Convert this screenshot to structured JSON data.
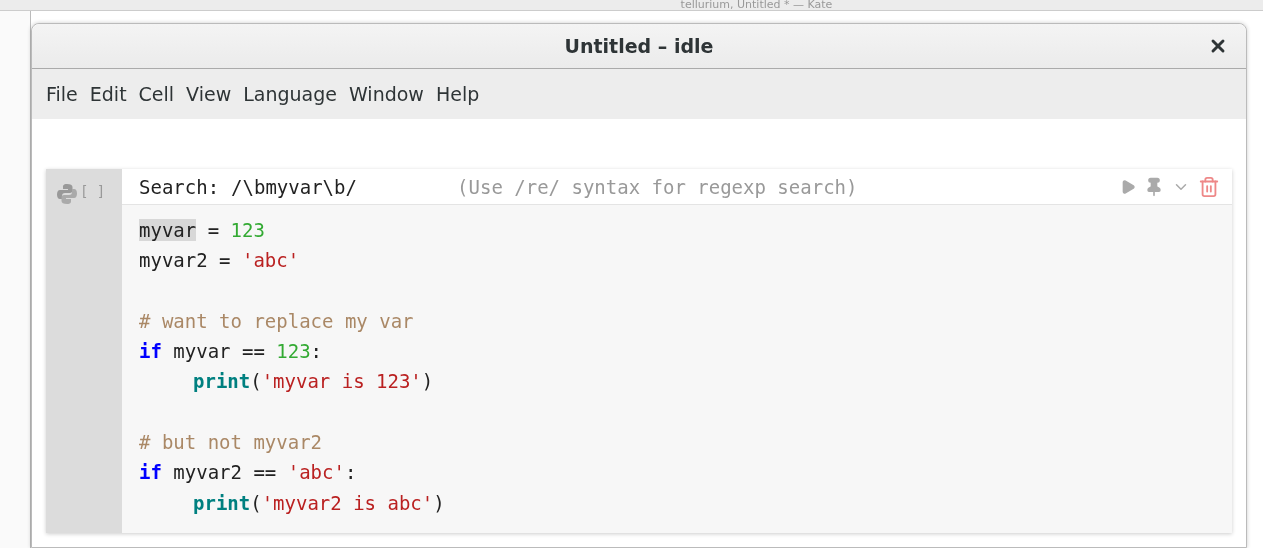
{
  "background_window": {
    "title": "tellurium, Untitled * — Kate"
  },
  "window": {
    "title": "Untitled – idle"
  },
  "menu": [
    "File",
    "Edit",
    "Cell",
    "View",
    "Language",
    "Window",
    "Help"
  ],
  "cell": {
    "prompt": "[ ]",
    "search": {
      "label": "Search:",
      "value": "/\\bmyvar\\b/",
      "hint": "(Use /re/ syntax for regexp search)"
    },
    "lines": [
      {
        "indent": false,
        "tokens": [
          {
            "kind": "name",
            "text": "myvar",
            "match": true
          },
          {
            "kind": "op",
            "text": " = ",
            "match": false
          },
          {
            "kind": "number",
            "text": "123",
            "match": false
          }
        ]
      },
      {
        "indent": false,
        "tokens": [
          {
            "kind": "name",
            "text": "myvar2",
            "match": false
          },
          {
            "kind": "op",
            "text": " = ",
            "match": false
          },
          {
            "kind": "string",
            "text": "'abc'",
            "match": false
          }
        ]
      },
      {
        "kind": "blank"
      },
      {
        "indent": false,
        "tokens": [
          {
            "kind": "comment",
            "text": "# want to replace my var",
            "match": false
          }
        ]
      },
      {
        "indent": false,
        "tokens": [
          {
            "kind": "keyword",
            "text": "if",
            "match": false
          },
          {
            "kind": "name",
            "text": " myvar == ",
            "match": false
          },
          {
            "kind": "number",
            "text": "123",
            "match": false
          },
          {
            "kind": "op",
            "text": ":",
            "match": false
          }
        ]
      },
      {
        "indent": true,
        "tokens": [
          {
            "kind": "builtin",
            "text": "print",
            "match": false
          },
          {
            "kind": "op",
            "text": "(",
            "match": false
          },
          {
            "kind": "string",
            "text": "'myvar is 123'",
            "match": false
          },
          {
            "kind": "op",
            "text": ")",
            "match": false
          }
        ]
      },
      {
        "kind": "blank"
      },
      {
        "indent": false,
        "tokens": [
          {
            "kind": "comment",
            "text": "# but not myvar2",
            "match": false
          }
        ]
      },
      {
        "indent": false,
        "tokens": [
          {
            "kind": "keyword",
            "text": "if",
            "match": false
          },
          {
            "kind": "name",
            "text": " myvar2 == ",
            "match": false
          },
          {
            "kind": "string",
            "text": "'abc'",
            "match": false
          },
          {
            "kind": "op",
            "text": ":",
            "match": false
          }
        ]
      },
      {
        "indent": true,
        "tokens": [
          {
            "kind": "builtin",
            "text": "print",
            "match": false
          },
          {
            "kind": "op",
            "text": "(",
            "match": false
          },
          {
            "kind": "string",
            "text": "'myvar2 is abc'",
            "match": false
          },
          {
            "kind": "op",
            "text": ")",
            "match": false
          }
        ]
      }
    ]
  }
}
